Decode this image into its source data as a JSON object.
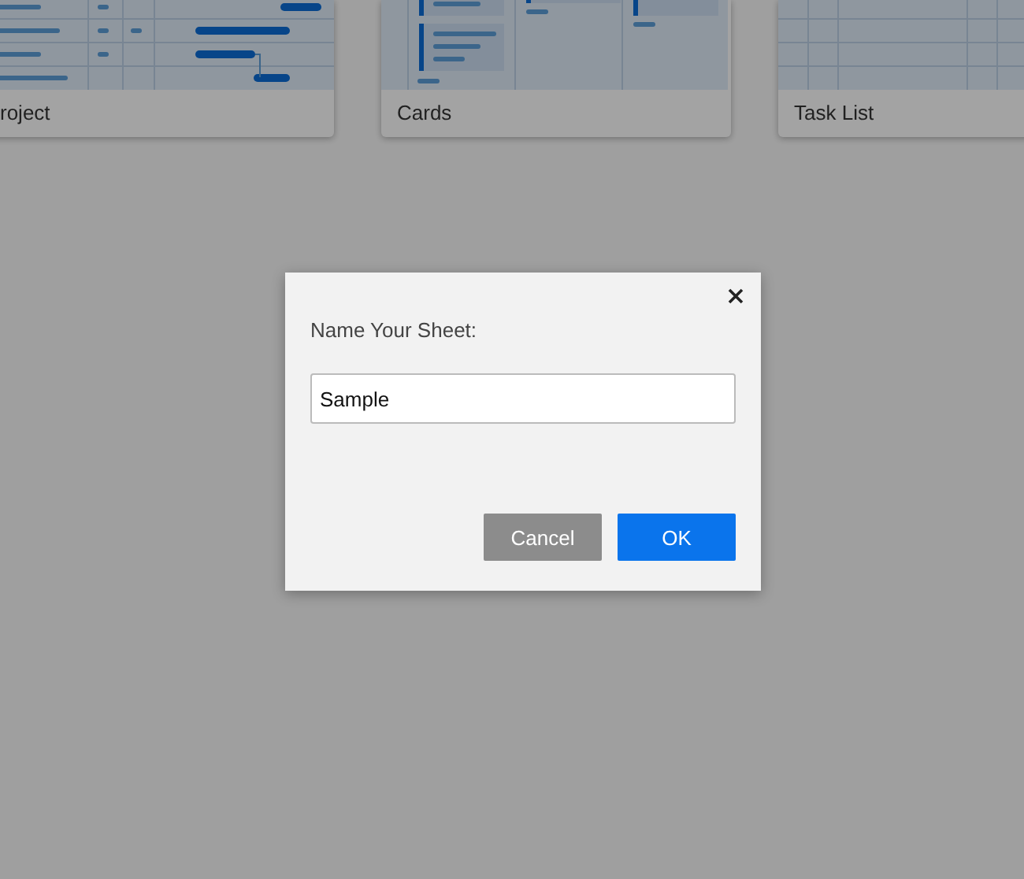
{
  "templates": [
    {
      "label": "roject",
      "kind": "gantt"
    },
    {
      "label": "Cards",
      "kind": "cards"
    },
    {
      "label": "Task List",
      "kind": "grid"
    }
  ],
  "dialog": {
    "label": "Name Your Sheet:",
    "input": {
      "value": "Sample"
    },
    "buttons": [
      {
        "label": "Cancel",
        "kind": "secondary"
      },
      {
        "label": "OK",
        "kind": "primary"
      }
    ]
  }
}
